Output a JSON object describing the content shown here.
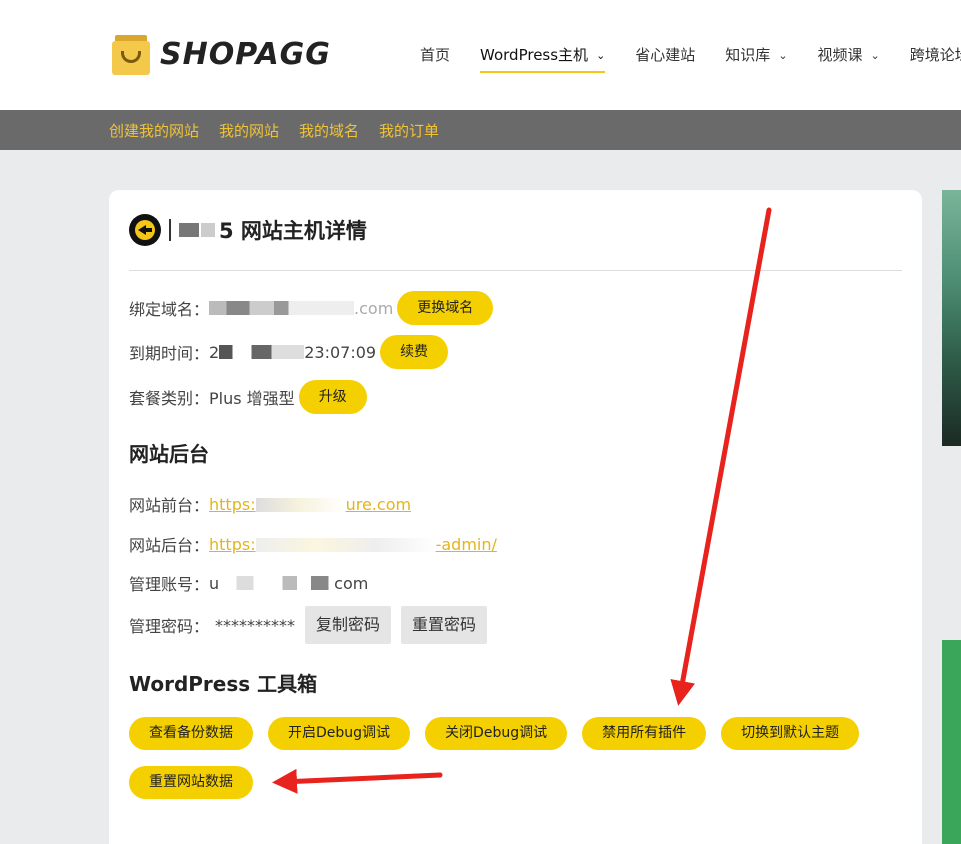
{
  "header": {
    "logo_text": "SHOPAGG",
    "nav": [
      {
        "label": "首页",
        "dropdown": false
      },
      {
        "label": "WordPress主机",
        "dropdown": true,
        "active": true
      },
      {
        "label": "省心建站",
        "dropdown": false
      },
      {
        "label": "知识库",
        "dropdown": true
      },
      {
        "label": "视频课",
        "dropdown": true
      },
      {
        "label": "跨境论坛",
        "dropdown": false
      }
    ]
  },
  "subnav": [
    "创建我的网站",
    "我的网站",
    "我的域名",
    "我的订单"
  ],
  "detail": {
    "title_suffix": "5 网站主机详情",
    "domain_label": "绑定域名：",
    "domain_value_tail": ".com",
    "change_domain_btn": "更换域名",
    "expiry_label": "到期时间：",
    "expiry_value_head": "2",
    "expiry_value_tail": "23:07:09",
    "renew_btn": "续费",
    "plan_label": "套餐类别：",
    "plan_value": "Plus 增强型",
    "upgrade_btn": "升级"
  },
  "backend": {
    "heading": "网站后台",
    "front_label": "网站前台：",
    "front_head": "https:",
    "front_tail": "ure.com",
    "admin_label": "网站后台：",
    "admin_head": "https:",
    "admin_tail": "-admin/",
    "account_label": "管理账号：",
    "account_head": "u",
    "account_tail": "com",
    "password_label": "管理密码：",
    "password_value": "**********",
    "copy_btn": "复制密码",
    "reset_btn": "重置密码"
  },
  "toolbox": {
    "heading": "WordPress 工具箱",
    "buttons": [
      "查看备份数据",
      "开启Debug调试",
      "关闭Debug调试",
      "禁用所有插件",
      "切换到默认主题",
      "重置网站数据"
    ]
  },
  "colors": {
    "accent": "#f5d000",
    "subbar": "#6a6a6a",
    "link": "#e3b51a",
    "arrow": "#e8221c"
  }
}
